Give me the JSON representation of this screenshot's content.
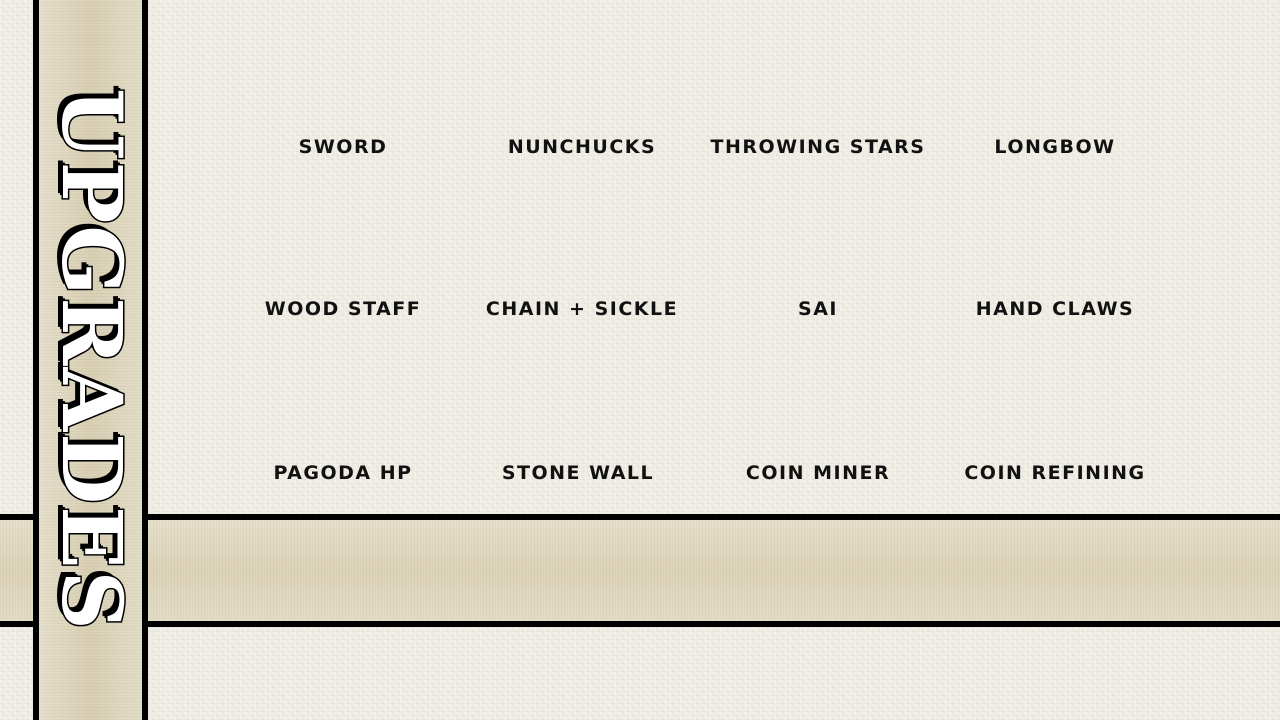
{
  "title": "UPGRADES",
  "upgrades": [
    {
      "label": "SWORD"
    },
    {
      "label": "NUNCHUCKS"
    },
    {
      "label": "THROWING STARS"
    },
    {
      "label": "LONGBOW"
    },
    {
      "label": "WOOD STAFF"
    },
    {
      "label": "CHAIN + SICKLE"
    },
    {
      "label": "SAI"
    },
    {
      "label": "HAND CLAWS"
    },
    {
      "label": "PAGODA HP"
    },
    {
      "label": "STONE WALL"
    },
    {
      "label": "COIN MINER"
    },
    {
      "label": "COIN REFINING"
    }
  ]
}
